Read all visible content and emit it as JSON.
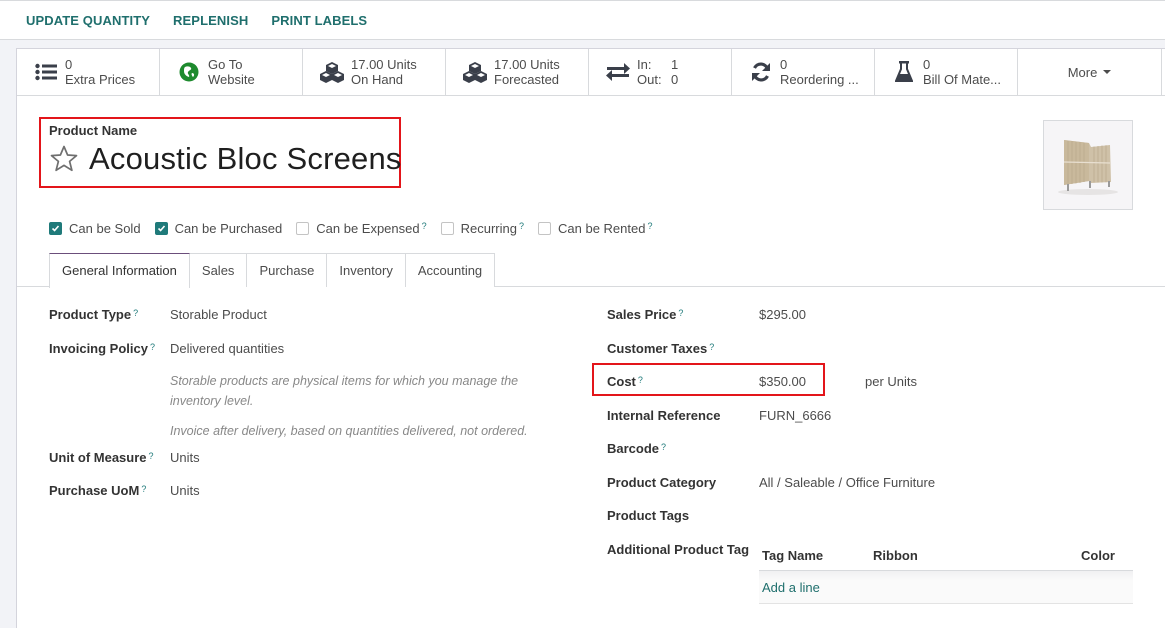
{
  "topbar": {
    "buttons": [
      "UPDATE QUANTITY",
      "REPLENISH",
      "PRINT LABELS"
    ]
  },
  "smart_buttons": [
    {
      "icon": "list-icon",
      "value": "0",
      "label": "Extra Prices"
    },
    {
      "icon": "globe-icon",
      "value": "Go To",
      "label": "Website"
    },
    {
      "icon": "cubes-icon",
      "value": "17.00 Units",
      "label": "On Hand"
    },
    {
      "icon": "cubes-icon",
      "value": "17.00 Units",
      "label": "Forecasted"
    },
    {
      "icon": "exchange-icon",
      "in_label": "In:",
      "in_value": "1",
      "out_label": "Out:",
      "out_value": "0"
    },
    {
      "icon": "refresh-icon",
      "value": "0",
      "label": "Reordering ..."
    },
    {
      "icon": "flask-icon",
      "value": "0",
      "label": "Bill Of Mate..."
    },
    {
      "label": "More",
      "icon": "caret-down-icon"
    }
  ],
  "product": {
    "name_label": "Product Name",
    "name": "Acoustic Bloc Screens",
    "favorite": false,
    "image_alt": "Acoustic screen panel"
  },
  "checkboxes": [
    {
      "label": "Can be Sold",
      "checked": true,
      "help": false
    },
    {
      "label": "Can be Purchased",
      "checked": true,
      "help": false
    },
    {
      "label": "Can be Expensed",
      "checked": false,
      "help": true
    },
    {
      "label": "Recurring",
      "checked": false,
      "help": true
    },
    {
      "label": "Can be Rented",
      "checked": false,
      "help": true
    }
  ],
  "tabs": [
    {
      "label": "General Information",
      "active": true
    },
    {
      "label": "Sales",
      "active": false
    },
    {
      "label": "Purchase",
      "active": false
    },
    {
      "label": "Inventory",
      "active": false
    },
    {
      "label": "Accounting",
      "active": false
    }
  ],
  "left_fields": {
    "product_type": {
      "label": "Product Type",
      "value": "Storable Product"
    },
    "invoicing_policy": {
      "label": "Invoicing Policy",
      "value": "Delivered quantities"
    },
    "help_storable": "Storable products are physical items for which you manage the inventory level.",
    "help_invoice": "Invoice after delivery, based on quantities delivered, not ordered.",
    "uom": {
      "label": "Unit of Measure",
      "value": "Units"
    },
    "purchase_uom": {
      "label": "Purchase UoM",
      "value": "Units"
    }
  },
  "right_fields": {
    "sales_price": {
      "label": "Sales Price",
      "value": "$295.00"
    },
    "customer_taxes": {
      "label": "Customer Taxes",
      "value": ""
    },
    "cost": {
      "label": "Cost",
      "value": "$350.00",
      "suffix": "per Units"
    },
    "internal_reference": {
      "label": "Internal Reference",
      "value": "FURN_6666"
    },
    "barcode": {
      "label": "Barcode",
      "value": ""
    },
    "product_category": {
      "label": "Product Category",
      "value": "All / Saleable / Office Furniture"
    },
    "product_tags": {
      "label": "Product Tags",
      "value": ""
    },
    "additional_tags": {
      "label": "Additional Product Tag"
    }
  },
  "tag_table": {
    "columns": [
      "Tag Name",
      "Ribbon",
      "Color"
    ],
    "add_line": "Add a line"
  },
  "colors": {
    "accent": "#1f7a7a",
    "highlight_box": "#e3151a",
    "tab_active_border": "#6b4e7b"
  }
}
